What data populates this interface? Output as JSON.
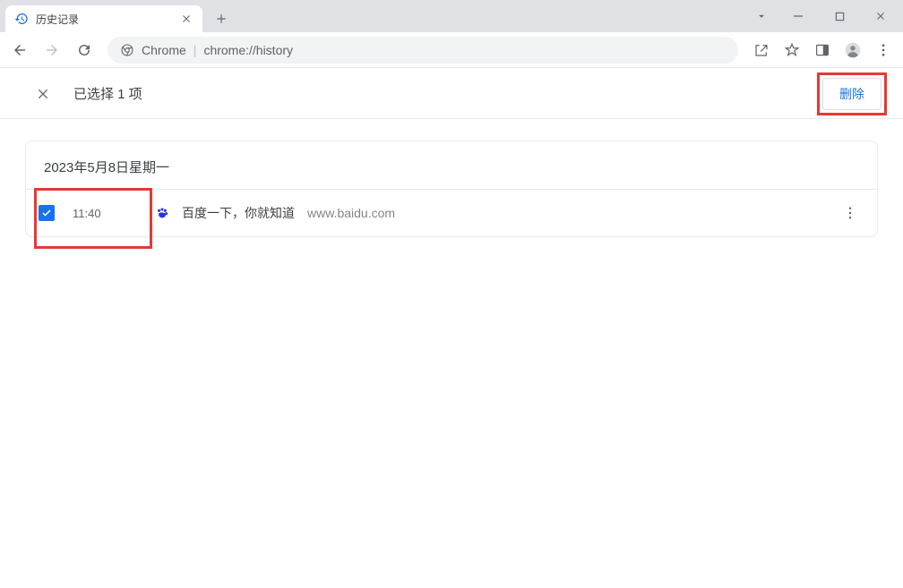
{
  "tab": {
    "title": "历史记录"
  },
  "omnibox": {
    "prefix": "Chrome",
    "url": "chrome://history"
  },
  "selection_bar": {
    "count_text": "已选择 1 项",
    "delete_label": "删除"
  },
  "history": {
    "date_heading": "2023年5月8日星期一",
    "entries": [
      {
        "time": "11:40",
        "title": "百度一下，你就知道",
        "domain": "www.baidu.com",
        "checked": true
      }
    ]
  }
}
